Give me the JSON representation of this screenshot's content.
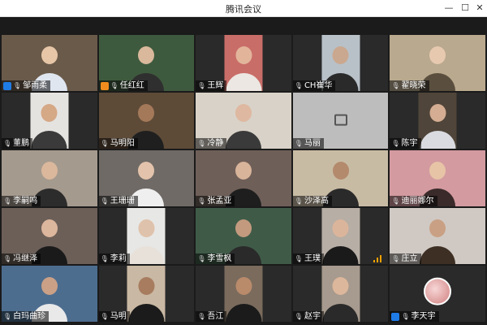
{
  "window": {
    "title": "腾讯会议"
  },
  "colors": {
    "host_blue": "#1f7be6",
    "host_orange": "#f08c1e",
    "signal": "#f0a000"
  },
  "participants": [
    {
      "name": "邹雨柔",
      "badge": "host-blue",
      "bg": "#6a5a4a",
      "skin": "#e7c6a8",
      "shirt": "#dfe6ef"
    },
    {
      "name": "任红红",
      "badge": "host-orange",
      "bg": "#3e5a3e",
      "skin": "#d9b89c",
      "shirt": "#2f2f2f"
    },
    {
      "name": "王辉",
      "badge": "",
      "bg": "#c96d68",
      "skin": "#e2b59b",
      "shirt": "#ece7e2",
      "narrow": true
    },
    {
      "name": "CH崔华",
      "badge": "",
      "bg": "#b8c1c8",
      "skin": "#caa88f",
      "shirt": "#2a2a2a",
      "narrow": true
    },
    {
      "name": "翟晓荣",
      "badge": "",
      "bg": "#b9a98e",
      "skin": "#e7c9b0",
      "shirt": "#5a4e3e"
    },
    {
      "name": "董鹏",
      "badge": "",
      "bg": "#e5e3e0",
      "skin": "#d5a886",
      "shirt": "#3a3a3a",
      "narrow": true
    },
    {
      "name": "马明阳",
      "badge": "",
      "bg": "#5d4b38",
      "skin": "#a4795a",
      "shirt": "#1f1f1f"
    },
    {
      "name": "冷静",
      "badge": "",
      "bg": "#d9d2c8",
      "skin": "#deb8a0",
      "shirt": "#3a3a3a"
    },
    {
      "name": "马丽",
      "badge": "",
      "bg": "#bdbdbd",
      "skin": "",
      "shirt": "",
      "camoff": true
    },
    {
      "name": "陈宇",
      "badge": "",
      "bg": "#50453a",
      "skin": "#d4ad92",
      "shirt": "#d9dbe0",
      "narrow": true
    },
    {
      "name": "李嗣鸣",
      "badge": "",
      "bg": "#a59a8e",
      "skin": "#dbb89c",
      "shirt": "#2c2c2c"
    },
    {
      "name": "王珊珊",
      "badge": "",
      "bg": "#6f6a66",
      "skin": "#e3c3ab",
      "shirt": "#efefef"
    },
    {
      "name": "张孟亚",
      "badge": "",
      "bg": "#6e5f58",
      "skin": "#d8b49a",
      "shirt": "#1e1e1e"
    },
    {
      "name": "沙泽高",
      "badge": "",
      "bg": "#c8bba4",
      "skin": "#b48a6c",
      "shirt": "#2a2a2a"
    },
    {
      "name": "迪丽娜尔",
      "badge": "",
      "bg": "#d39aa0",
      "skin": "#e7c4a6",
      "shirt": "#3a2a2a"
    },
    {
      "name": "冯继泽",
      "badge": "",
      "bg": "#6c5f58",
      "skin": "#dcb69d",
      "shirt": "#1a1a1a"
    },
    {
      "name": "李莉",
      "badge": "",
      "bg": "#e7e7e5",
      "skin": "#dfc2ab",
      "shirt": "#e7e1da",
      "narrow": true
    },
    {
      "name": "李雪枫",
      "badge": "",
      "bg": "#3f5b48",
      "skin": "#c39a7e",
      "shirt": "#2a2a2a"
    },
    {
      "name": "王璞",
      "badge": "",
      "bg": "#b7aea5",
      "skin": "#dbb59b",
      "shirt": "#1a1a1a",
      "narrow": true,
      "signal": true
    },
    {
      "name": "庄立",
      "badge": "",
      "bg": "#d0c9c3",
      "skin": "#c9a084",
      "shirt": "#3e2f24"
    },
    {
      "name": "白玛曲珍",
      "badge": "",
      "bg": "#4d6d8f",
      "skin": "#caa086",
      "shirt": "#e9e9ea"
    },
    {
      "name": "马明",
      "badge": "",
      "bg": "#c9b8a3",
      "skin": "#a77c5f",
      "shirt": "#1b1b1b",
      "narrow": true
    },
    {
      "name": "吾江",
      "badge": "",
      "bg": "#7a6b5d",
      "skin": "#b98b6b",
      "shirt": "#1b1b1b",
      "narrow": true
    },
    {
      "name": "赵宇",
      "badge": "",
      "bg": "#a79a8e",
      "skin": "#dcb79b",
      "shirt": "#2a2a2a",
      "narrow": true
    },
    {
      "name": "李天宇",
      "badge": "host-blue",
      "bg": "#2a2a2a",
      "skin": "",
      "shirt": "",
      "avatar": true
    }
  ]
}
